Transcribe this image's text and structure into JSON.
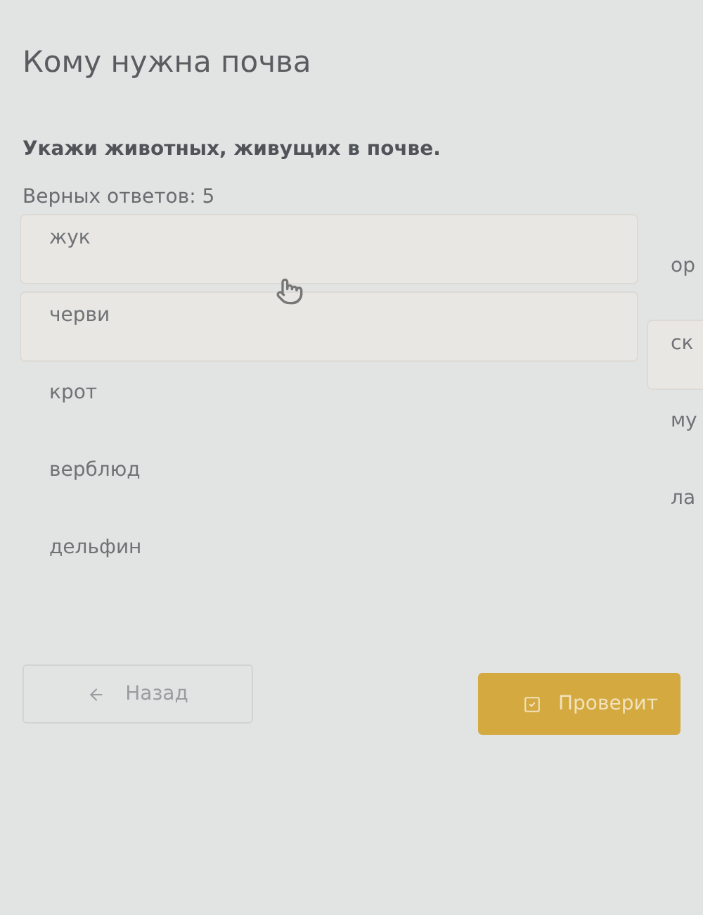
{
  "title": "Кому нужна почва",
  "question": "Укажи животных, живущих в почве.",
  "answer_count": "Верных ответов: 5",
  "options_left": [
    {
      "label": "жук",
      "selected": true
    },
    {
      "label": "черви",
      "selected": true
    },
    {
      "label": "крот",
      "selected": false
    },
    {
      "label": "верблюд",
      "selected": false
    },
    {
      "label": "дельфин",
      "selected": false
    }
  ],
  "options_right": [
    {
      "label": "ор",
      "selected": false
    },
    {
      "label": "ск",
      "selected": true
    },
    {
      "label": "му",
      "selected": false
    },
    {
      "label": "ла",
      "selected": false
    }
  ],
  "back_button": {
    "label": "Назад",
    "disabled": true
  },
  "check_button": {
    "label": "Проверит"
  }
}
